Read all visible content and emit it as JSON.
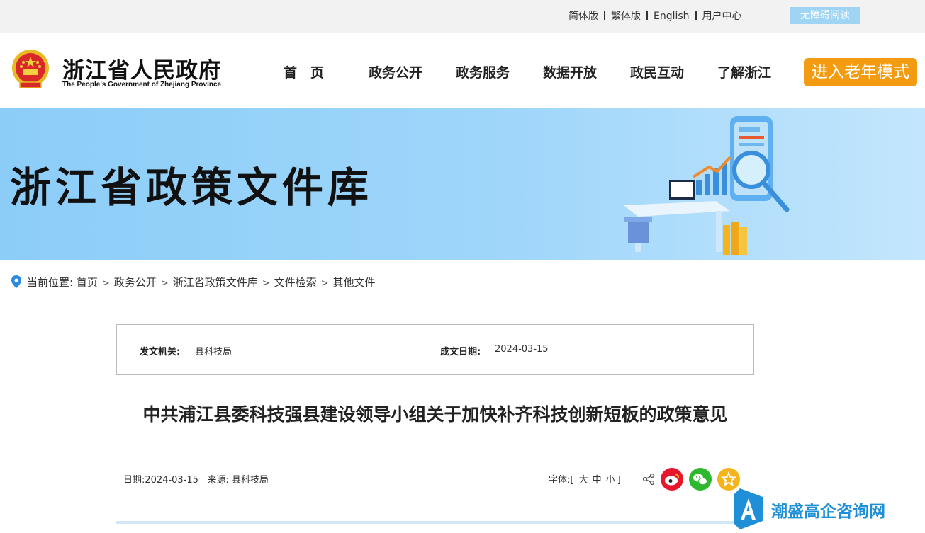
{
  "topbar": {
    "links": [
      "简体版",
      "繁体版",
      "English",
      "用户中心"
    ],
    "accessibility_label": "无障碍阅读"
  },
  "header": {
    "title": "浙江省人民政府",
    "subtitle": "The People's Government of Zhejiang Province",
    "nav": [
      "首　页",
      "政务公开",
      "政务服务",
      "数据开放",
      "政民互动",
      "了解浙江"
    ],
    "elder_mode_label": "进入老年模式"
  },
  "banner": {
    "title": "浙江省政策文件库"
  },
  "breadcrumb": {
    "prefix": "当前位置:",
    "items": [
      "首页",
      "政务公开",
      "浙江省政策文件库",
      "文件检索",
      "其他文件"
    ]
  },
  "info": {
    "issuer_label": "发文机关:",
    "issuer_value": "县科技局",
    "date_label": "成文日期:",
    "date_value": "2024-03-15"
  },
  "article": {
    "title": "中共浦江县委科技强县建设领导小组关于加快补齐科技创新短板的政策意见",
    "date_label": "日期:",
    "date": "2024-03-15",
    "source_label": "来源:",
    "source": "县科技局",
    "font_label": "字体:",
    "font_sizes": [
      "大",
      "中",
      "小"
    ]
  },
  "watermark": {
    "text": "潮盛高企咨询网"
  },
  "colors": {
    "accent_orange": "#f39c12",
    "banner_blue": "#9fd6fa",
    "access_blue": "#9fd4f5",
    "weibo_red": "#e6162d",
    "wechat_green": "#2eb82e",
    "fav_yellow": "#f5b51a",
    "watermark_blue": "#1f8fd8"
  },
  "icons": [
    "national-emblem-icon",
    "location-pin-icon",
    "share-icon",
    "weibo-icon",
    "wechat-icon",
    "favorite-star-icon",
    "watermark-logo-icon"
  ]
}
